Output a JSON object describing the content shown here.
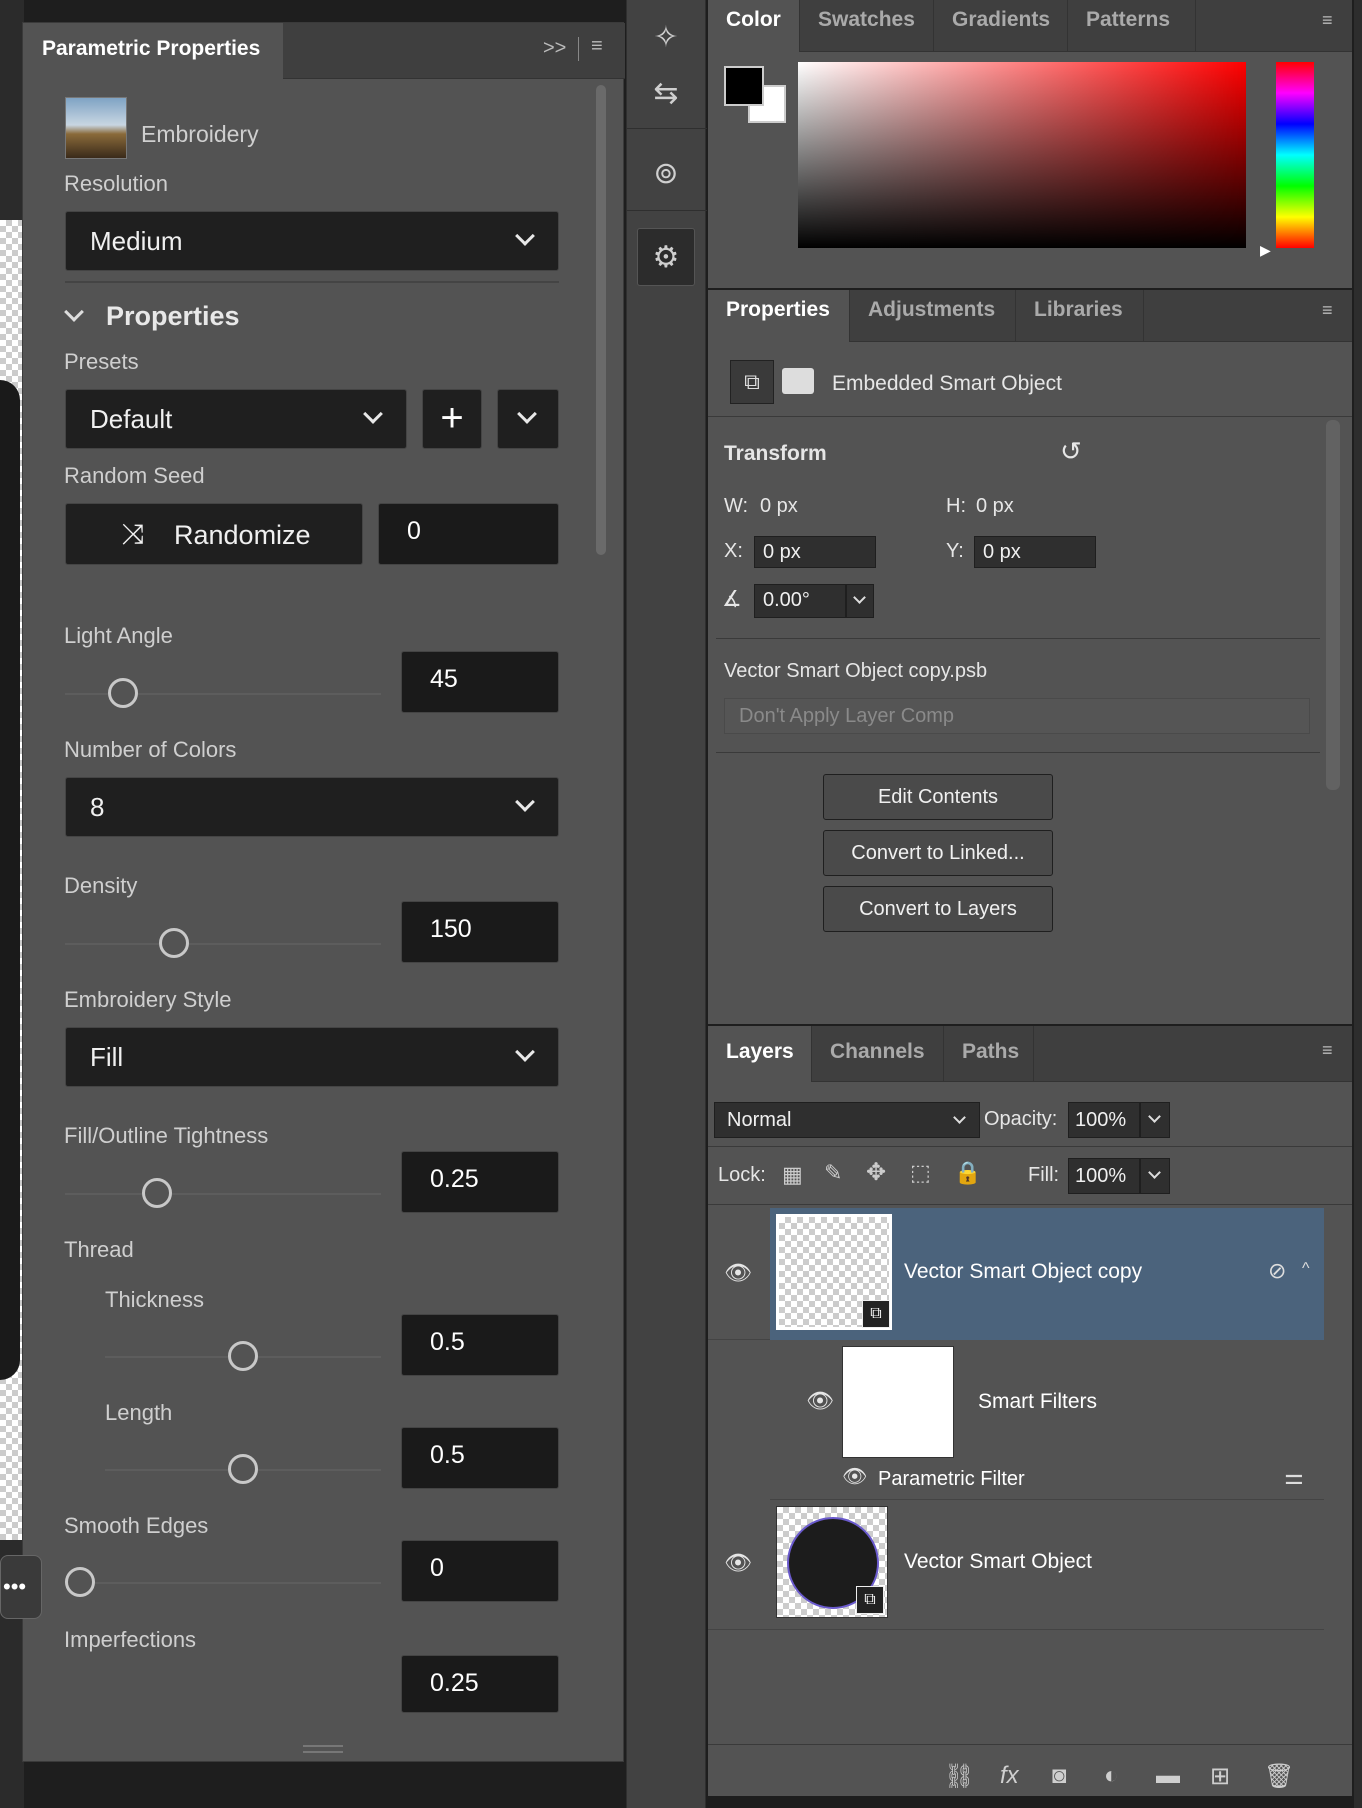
{
  "parametric": {
    "title": "Parametric Properties",
    "filter_name": "Embroidery",
    "resolution_label": "Resolution",
    "resolution_value": "Medium",
    "properties_heading": "Properties",
    "presets_label": "Presets",
    "presets_value": "Default",
    "random_seed_label": "Random Seed",
    "randomize_label": "Randomize",
    "seed_value": "0",
    "light_angle_label": "Light Angle",
    "light_angle_value": "45",
    "colors_label": "Number of Colors",
    "colors_value": "8",
    "density_label": "Density",
    "density_value": "150",
    "style_label": "Embroidery Style",
    "style_value": "Fill",
    "tightness_label": "Fill/Outline Tightness",
    "tightness_value": "0.25",
    "thread_label": "Thread",
    "thickness_label": "Thickness",
    "thickness_value": "0.5",
    "length_label": "Length",
    "length_value": "0.5",
    "smooth_label": "Smooth Edges",
    "smooth_value": "0",
    "imperfections_label": "Imperfections",
    "imperfections_value": "0.25",
    "slider_levels": {
      "light_angle": 0.15,
      "density": 0.33,
      "tightness": 0.27,
      "thickness": 0.5,
      "length": 0.5,
      "smooth": 0.0
    }
  },
  "color_panel": {
    "tabs": [
      "Color",
      "Swatches",
      "Gradients",
      "Patterns"
    ],
    "foreground": "#000000",
    "background": "#ffffff"
  },
  "properties_panel": {
    "tabs": [
      "Properties",
      "Adjustments",
      "Libraries"
    ],
    "object_type": "Embedded Smart Object",
    "transform_label": "Transform",
    "w_label": "W:",
    "w_value": "0 px",
    "h_label": "H:",
    "h_value": "0 px",
    "x_label": "X:",
    "x_value": "0 px",
    "y_label": "Y:",
    "y_value": "0 px",
    "angle_value": "0.00°",
    "file_name": "Vector Smart Object copy.psb",
    "layer_comp": "Don't Apply Layer Comp",
    "edit_contents": "Edit Contents",
    "convert_linked": "Convert to Linked...",
    "convert_layers": "Convert to Layers"
  },
  "layers_panel": {
    "tabs": [
      "Layers",
      "Channels",
      "Paths"
    ],
    "blend_mode": "Normal",
    "opacity_label": "Opacity:",
    "opacity_value": "100%",
    "lock_label": "Lock:",
    "fill_label": "Fill:",
    "fill_value": "100%",
    "layers": [
      {
        "name": "Vector Smart Object copy"
      },
      {
        "name": "Smart Filters"
      },
      {
        "name": "Parametric Filter"
      },
      {
        "name": "Vector Smart Object"
      }
    ]
  }
}
